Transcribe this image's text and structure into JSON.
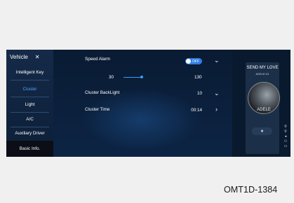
{
  "sidebar": {
    "title": "Vehicle",
    "close": "✕",
    "items": [
      {
        "label": "Intelligent Key"
      },
      {
        "label": "Cluster"
      },
      {
        "label": "Light"
      },
      {
        "label": "A/C"
      },
      {
        "label": "Auxiliary Driver"
      },
      {
        "label": "Basic Info."
      }
    ]
  },
  "settings": {
    "speed_alarm": {
      "label": "Speed Alarm",
      "toggle_text": "OFF",
      "min": "30",
      "max": "130"
    },
    "cluster_backlight": {
      "label": "Cluster BackLight",
      "value": "10"
    },
    "cluster_time": {
      "label": "Cluster Time",
      "value": "00:14"
    }
  },
  "media": {
    "song": "SEND MY LOVE",
    "artist": "ADELE-01",
    "album_text": "ADELE",
    "pause_symbol": "⏸"
  },
  "figure_code": "OMT1D-1384"
}
